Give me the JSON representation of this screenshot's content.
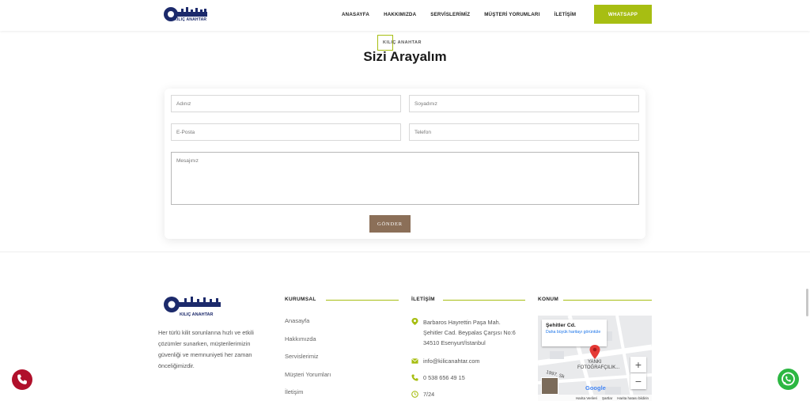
{
  "header": {
    "logo_alt": "KILIÇ ANAHTAR",
    "nav": [
      "ANASAYFA",
      "HAKKIMIZDA",
      "SERVİSLERİMİZ",
      "MÜŞTERİ YORUMLARI",
      "İLETİŞİM"
    ],
    "whatsapp_label": "WHATSAPP"
  },
  "section": {
    "subtitle": "KILIÇ ANAHTAR",
    "title": "Sizi Arayalım"
  },
  "form": {
    "first_name_placeholder": "Adınız",
    "last_name_placeholder": "Soyadınız",
    "email_placeholder": "E-Posta",
    "phone_placeholder": "Telefon",
    "message_placeholder": "Mesajınız",
    "submit_label": "GÖNDER"
  },
  "footer": {
    "about": "Her türlü kilit sorunlarına hızlı ve etkili çözümler sunarken, müşterilerimizin güvenliği ve memnuniyeti her zaman önceliğimizdir.",
    "corporate_heading": "KURUMSAL",
    "corporate_links": [
      "Anasayfa",
      "Hakkımızda",
      "Servislerimiz",
      "Müşteri Yorumları",
      "İletişim"
    ],
    "contact_heading": "İLETİŞİM",
    "address": "Barbaros Hayrettin Paşa Mah. Şehitler Cad. Beypalas Çarşısı No:6 34510 Esenyurt/İstanbul",
    "email": "info@kilicanahtar.com",
    "phone": "0 538 656 49 15",
    "hours": "7/24",
    "location_heading": "KONUM",
    "map": {
      "place": "Şehitler Cd.",
      "link": "Daha büyük haritayı görüntüle",
      "label1": "YANKI",
      "label2": "FOTOĞRAFÇILIK...",
      "road": "1997. Sk",
      "brand": "Google",
      "zoom_in": "+",
      "zoom_out": "−",
      "footer_items": [
        "Harita Verileri",
        "Şartlar",
        "Harita hatası bildirin"
      ]
    }
  },
  "colors": {
    "accent": "#a7be12",
    "button": "#8b6f58",
    "phone_float": "#b0102b",
    "whatsapp_float": "#2cb742"
  }
}
